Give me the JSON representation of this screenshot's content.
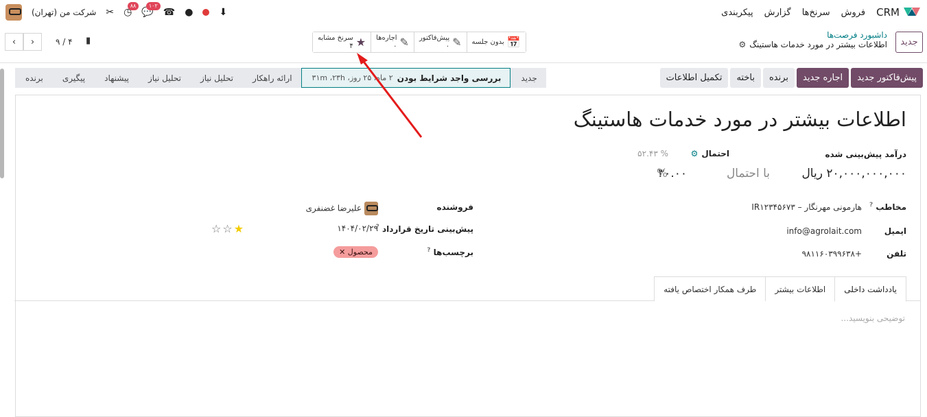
{
  "topbar": {
    "brand": "CRM",
    "menu": [
      "فروش",
      "سرنخ‌ها",
      "گزارش",
      "پیکربندی"
    ],
    "company": "شرکت من (تهران)",
    "badge_chat": "۱۰۲",
    "badge_activity": "۸۸"
  },
  "control": {
    "new_label": "جدید",
    "breadcrumb_parent": "داشبورد فرصت‌ها",
    "breadcrumb_current": "اطلاعات بیشتر در مورد خدمات هاستینگ",
    "smart": [
      {
        "icon": "calendar-icon",
        "line1": "بدون جلسه",
        "line2": ""
      },
      {
        "icon": "edit-icon",
        "line1": "پیش‌فاکتور",
        "line2": "۰"
      },
      {
        "icon": "edit-icon",
        "line1": "اجاره‌ها",
        "line2": "۰"
      },
      {
        "icon": "star-icon",
        "line1": "سرنخ مشابه",
        "line2": "۴"
      }
    ],
    "pager": "۹ / ۴"
  },
  "actions": [
    "پیش‌فاکتور جدید",
    "اجاره جدید",
    "برنده",
    "باخته",
    "تکمیل اطلاعات"
  ],
  "stages": {
    "items": [
      "جدید",
      "بررسی واجد شرایط بودن",
      "ارائه راهکار",
      "تحلیل نیاز",
      "تحلیل نیاز",
      "پیشنهاد",
      "پیگیری",
      "برنده"
    ],
    "current_time": "۲ ماه، ۲۵ روز، ۳۱m ،۲۳h"
  },
  "form": {
    "title": "اطلاعات بیشتر در مورد خدمات هاستینگ",
    "rev_label": "درآمد پیش‌بینی شده",
    "prob_label": "احتمال",
    "prob_auto": "% ۵۲.۴۳",
    "revenue": "۲۰,۰۰۰,۰۰۰,۰۰۰",
    "currency": "ریال",
    "with_prob": "با احتمال",
    "prob_value": "۳۰.۰۰",
    "pct": "%",
    "contact_label": "مخاطب",
    "contact": "هارمونی مهرنگار – IR۱۲۳۴۵۶۷۳",
    "email_label": "ایمیل",
    "email": "info@agrolait.com",
    "phone_label": "تلفن",
    "phone": "+۹۸۱۱۶۰۳۹۹۶۳۸",
    "salesperson_label": "فروشنده",
    "salesperson": "علیرضا غضنفری",
    "date_label": "پیش‌بینی تاریخ قرارداد",
    "date": "۱۴۰۴/۰۲/۲۹",
    "tags_label": "برچسب‌ها",
    "tag": "محصول",
    "priority": 1
  },
  "tabs": [
    "یادداشت داخلی",
    "اطلاعات بیشتر",
    "طرف همکار اختصاص یافته"
  ],
  "notes_placeholder": "توضیحی بنویسید..."
}
